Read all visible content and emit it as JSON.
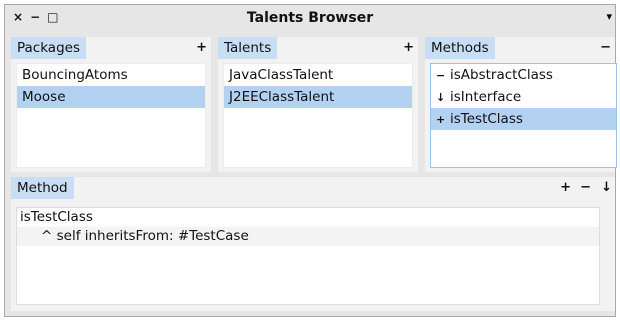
{
  "window": {
    "title": "Talents Browser",
    "close_glyph": "×",
    "minimize_glyph": "−",
    "maximize_glyph": "□",
    "menu_glyph": "▾"
  },
  "packages": {
    "tab_label": "Packages",
    "action": "+",
    "items": [
      {
        "label": "BouncingAtoms",
        "selected": false
      },
      {
        "label": "Moose",
        "selected": true
      }
    ]
  },
  "talents": {
    "tab_label": "Talents",
    "action": "+",
    "items": [
      {
        "label": "JavaClassTalent",
        "selected": false
      },
      {
        "label": "J2EEClassTalent",
        "selected": true
      }
    ]
  },
  "methods": {
    "tab_label": "Methods",
    "action": "−",
    "items": [
      {
        "mark": "−",
        "label": "isAbstractClass",
        "selected": false
      },
      {
        "mark": "↓",
        "label": "isInterface",
        "selected": false
      },
      {
        "mark": "+",
        "label": "isTestClass",
        "selected": true
      }
    ]
  },
  "method_editor": {
    "tab_label": "Method",
    "actions": [
      "+",
      "−",
      "↓"
    ],
    "lines": [
      "isTestClass",
      "^ self inheritsFrom: #TestCase"
    ]
  },
  "colors": {
    "tab": "#c8def4",
    "selection": "#b3d2f2",
    "window_bg": "#e6e6e6"
  }
}
